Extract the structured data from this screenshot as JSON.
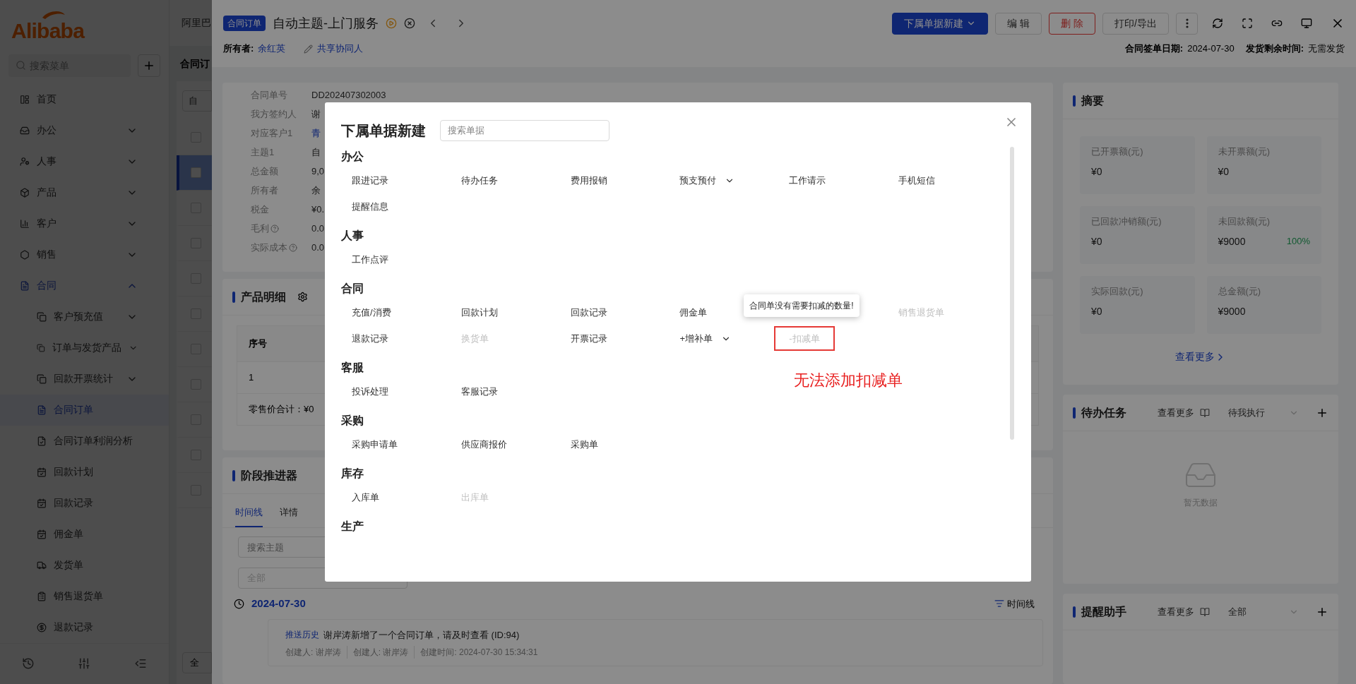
{
  "sidebar": {
    "logo": "Alibaba",
    "search": {
      "placeholder": "搜索菜单"
    },
    "items": [
      {
        "label": "首页",
        "selected": false
      },
      {
        "label": "办公",
        "selected": false,
        "expanded": false
      },
      {
        "label": "人事",
        "selected": false,
        "expanded": false
      },
      {
        "label": "产品",
        "selected": false,
        "expanded": false
      },
      {
        "label": "客户",
        "selected": false,
        "expanded": false
      },
      {
        "label": "销售",
        "selected": false,
        "expanded": false
      },
      {
        "label": "合同",
        "selected": true,
        "expanded": true,
        "children": [
          {
            "label": "客户预充值",
            "selected": false,
            "expanded": false
          },
          {
            "label": "订单与发货产品",
            "selected": false,
            "expanded": false
          },
          {
            "label": "回款开票统计",
            "selected": false,
            "expanded": false
          },
          {
            "label": "合同订单",
            "selected": true
          },
          {
            "label": "合同订单利润分析",
            "selected": false
          },
          {
            "label": "回款计划",
            "selected": false
          },
          {
            "label": "回款记录",
            "selected": false
          },
          {
            "label": "佣金单",
            "selected": false
          },
          {
            "label": "发货单",
            "selected": false
          },
          {
            "label": "销售退货单",
            "selected": false
          },
          {
            "label": "退款记录",
            "selected": false
          }
        ]
      }
    ]
  },
  "list_page": {
    "title": "阿里巴",
    "heading": "合同订",
    "search_value": "自",
    "bottom_button": "全",
    "rows": [
      {
        "checked": false,
        "selected": false
      },
      {
        "checked": false,
        "selected": true
      },
      {
        "checked": false,
        "selected": false
      },
      {
        "checked": false,
        "selected": false
      },
      {
        "checked": false,
        "selected": false
      },
      {
        "checked": false,
        "selected": false
      },
      {
        "checked": false,
        "selected": false
      },
      {
        "checked": false,
        "selected": false
      },
      {
        "checked": false,
        "selected": false
      },
      {
        "checked": false,
        "selected": false
      },
      {
        "checked": false,
        "selected": false
      }
    ]
  },
  "drawer": {
    "tag": "合同订单",
    "title": "自动主题-上门服务",
    "buttons": [
      {
        "label": "下属单据新建",
        "kind": "primary"
      },
      {
        "label": "编 辑",
        "kind": "default"
      },
      {
        "label": "删 除",
        "kind": "danger"
      },
      {
        "label": "打印/导出",
        "kind": "default"
      }
    ],
    "owner_label": "所有者:",
    "owner": "余红英",
    "share": "共享协同人",
    "sign_date_label": "合同签单日期:",
    "sign_date": "2024-07-30",
    "ship_label": "发货剩余时间:",
    "ship_value": "无需发货",
    "info": [
      {
        "label": "合同单号",
        "value": "DD202407302003"
      },
      {
        "label": "我方签约人",
        "value": "谢"
      },
      {
        "label": "对应客户1",
        "value": "青",
        "link": true
      },
      {
        "label": "主题1",
        "value": "自"
      },
      {
        "label": "总金额",
        "value": "9,0"
      },
      {
        "label": "所有者",
        "value": "余"
      },
      {
        "label": "税金",
        "value": "¥0."
      },
      {
        "label": "毛利",
        "value": "0.0",
        "help": true
      },
      {
        "label": "实际成本",
        "value": "0.0",
        "help": true
      }
    ],
    "product": {
      "title": "产品明细",
      "column": "序号",
      "row": "1",
      "total": "零售价合计：¥0"
    },
    "stage": {
      "title": "阶段推进器",
      "tabs": [
        {
          "label": "时间线",
          "selected": true
        },
        {
          "label": "详情",
          "selected": false
        }
      ],
      "search": {
        "placeholder": "搜索主题"
      },
      "filter": "全部",
      "date": "2024-07-30",
      "timeline_button": "时间线",
      "entry": {
        "tag": "推送历史",
        "text": "谢岸涛新增了一个合同订单，请及时查看 (ID:94)",
        "meta": [
          "创建人: 谢岸涛",
          "创建人: 谢岸涛",
          "创建时间: 2024-07-30 15:34:31"
        ]
      }
    },
    "summary": {
      "title": "摘要",
      "stats": [
        {
          "label": "已开票额(元)",
          "value": "¥0"
        },
        {
          "label": "未开票额(元)",
          "value": "¥0"
        },
        {
          "label": "已回款冲销额(元)",
          "value": "¥0"
        },
        {
          "label": "未回款额(元)",
          "value": "¥9000",
          "percent": "100%"
        },
        {
          "label": "实际回款(元)",
          "value": "¥0"
        },
        {
          "label": "总金额(元)",
          "value": "¥9000"
        }
      ],
      "more": "查看更多"
    },
    "todo": {
      "title": "待办任务",
      "more": "查看更多",
      "filter": "待我执行",
      "empty": "暂无数据"
    },
    "reminder": {
      "title": "提醒助手",
      "more": "查看更多",
      "filter": "全部"
    }
  },
  "modal": {
    "title": "下属单据新建",
    "search": {
      "placeholder": "搜索单据"
    },
    "sections": [
      {
        "title": "办公",
        "items": [
          {
            "label": "跟进记录",
            "disabled": false
          },
          {
            "label": "待办任务",
            "disabled": false
          },
          {
            "label": "费用报销",
            "disabled": false
          },
          {
            "label": "预支预付",
            "disabled": false,
            "dropdown": true
          },
          {
            "label": "工作请示",
            "disabled": false
          },
          {
            "label": "手机短信",
            "disabled": false
          },
          {
            "label": "提醒信息",
            "disabled": false
          }
        ]
      },
      {
        "title": "人事",
        "items": [
          {
            "label": "工作点评",
            "disabled": false
          }
        ]
      },
      {
        "title": "合同",
        "items": [
          {
            "label": "充值/消费",
            "disabled": false
          },
          {
            "label": "回款计划",
            "disabled": false
          },
          {
            "label": "回款记录",
            "disabled": false
          },
          {
            "label": "佣金单",
            "disabled": false
          },
          {
            "kind": "tooltip",
            "text": "合同单没有需要扣减的数量!"
          },
          {
            "label": "销售退货单",
            "disabled": true
          },
          {
            "label": "退款记录",
            "disabled": false
          },
          {
            "label": "换货单",
            "disabled": true
          },
          {
            "label": "开票记录",
            "disabled": false
          },
          {
            "label": "+增补单",
            "disabled": false,
            "dropdown": true
          },
          {
            "label": "-扣减单",
            "disabled": true,
            "highlighted": true,
            "note": "无法添加扣减单"
          }
        ]
      },
      {
        "title": "客服",
        "items": [
          {
            "label": "投诉处理",
            "disabled": false
          },
          {
            "label": "客服记录",
            "disabled": false
          }
        ]
      },
      {
        "title": "采购",
        "items": [
          {
            "label": "采购申请单",
            "disabled": false
          },
          {
            "label": "供应商报价",
            "disabled": false
          },
          {
            "label": "采购单",
            "disabled": false
          }
        ]
      },
      {
        "title": "库存",
        "items": [
          {
            "label": "入库单",
            "disabled": false
          },
          {
            "label": "出库单",
            "disabled": true
          }
        ]
      },
      {
        "title": "生产"
      }
    ]
  }
}
